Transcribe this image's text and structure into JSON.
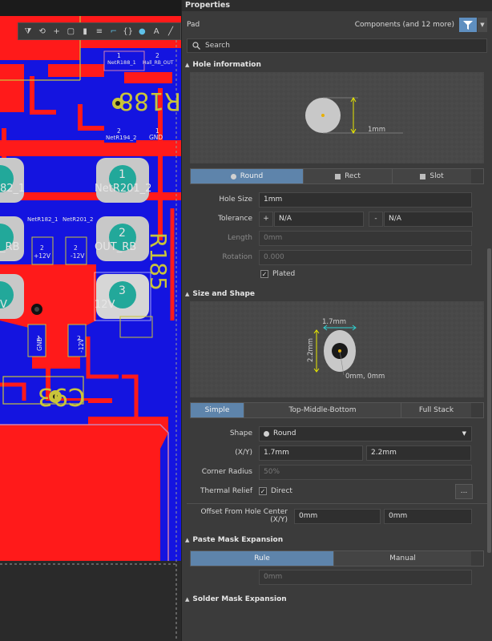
{
  "panel": {
    "title": "Properties",
    "object_type": "Pad",
    "components_label": "Components (and 12 more)",
    "search_placeholder": "Search"
  },
  "hole_info": {
    "header": "Hole information",
    "preview_dim": "1mm",
    "shape_tabs": [
      "Round",
      "Rect",
      "Slot"
    ],
    "active_shape": "Round",
    "hole_size_label": "Hole Size",
    "hole_size_value": "1mm",
    "tolerance_label": "Tolerance",
    "tol_plus_sign": "+",
    "tol_plus_value": "N/A",
    "tol_minus_sign": "-",
    "tol_minus_value": "N/A",
    "length_label": "Length",
    "length_value": "0mm",
    "rotation_label": "Rotation",
    "rotation_value": "0.000",
    "plated_label": "Plated",
    "plated_checked": true
  },
  "size_shape": {
    "header": "Size and Shape",
    "preview_x_dim": "1.7mm",
    "preview_y_dim": "2.2mm",
    "preview_origin": "0mm, 0mm",
    "mode_tabs": [
      "Simple",
      "Top-Middle-Bottom",
      "Full Stack"
    ],
    "active_mode": "Simple",
    "shape_label": "Shape",
    "shape_value": "Round",
    "xy_label": "(X/Y)",
    "x_value": "1.7mm",
    "y_value": "2.2mm",
    "corner_radius_label": "Corner Radius",
    "corner_radius_value": "50%",
    "thermal_relief_label": "Thermal Relief",
    "thermal_relief_value": "Direct",
    "thermal_relief_button": "...",
    "offset_label": "Offset From Hole Center (X/Y)",
    "offset_x": "0mm",
    "offset_y": "0mm"
  },
  "paste_mask": {
    "header": "Paste Mask Expansion",
    "tabs": [
      "Rule",
      "Manual"
    ],
    "active_tab": "Rule",
    "value": "0mm"
  },
  "solder_mask": {
    "header": "Solder Mask Expansion"
  },
  "pcb": {
    "net_labels": [
      "NetR188_1",
      "Hall_RB_OUT",
      "NetR194_2",
      "GND",
      "NetR182_1",
      "NetR201_2",
      "+12V",
      "-12V",
      "GND",
      "-12V"
    ],
    "pad_labels": [
      {
        "num": "1",
        "net": "NetR201_2"
      },
      {
        "num": "2",
        "net": "OUT_RB"
      },
      {
        "num": "3",
        "net": "12V"
      }
    ],
    "partial_labels": [
      "82_1",
      "_RB",
      "V"
    ],
    "pin_nums": [
      "1",
      "2",
      "2",
      "1",
      "2",
      "2",
      "1",
      "2"
    ],
    "designators": [
      "R188",
      "R185",
      "C93"
    ],
    "colors": {
      "top_copper": "#ff1a1a",
      "bottom_copper": "#1c1cff",
      "silkscreen": "#c9c43a",
      "pad": "#c8c8c8",
      "hole": "#22a89a"
    }
  },
  "toolbar_icons": [
    "filter-icon",
    "route-icon",
    "add-icon",
    "select-icon",
    "chart-icon",
    "align-icon",
    "track-icon",
    "bracket-icon",
    "pad-icon",
    "text-icon",
    "line-icon"
  ]
}
